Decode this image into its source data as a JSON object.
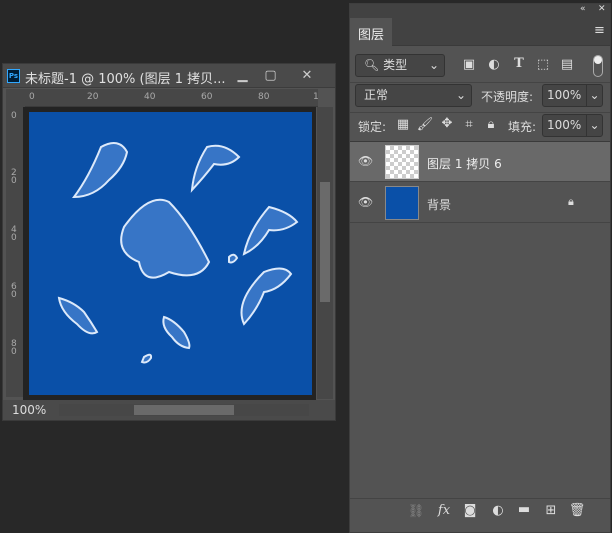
{
  "document": {
    "title": "未标题-1 @ 100% (图层 1 拷贝...",
    "app_icon": "Ps",
    "zoom": "100%",
    "ruler_top": [
      "0",
      "20",
      "40",
      "60",
      "80",
      "1"
    ],
    "ruler_left": [
      "0",
      "2\n0",
      "4\n0",
      "6\n0",
      "8\n0"
    ],
    "canvas_color": "#0a50a8"
  },
  "panel": {
    "tab": "图层",
    "filter": "类型",
    "blend_mode": "正常",
    "opacity_label": "不透明度:",
    "opacity": "100%",
    "lock_label": "锁定:",
    "fill_label": "填充:",
    "fill": "100%",
    "layers": [
      {
        "name": "图层 1 拷贝 6",
        "selected": true,
        "thumb": "transparent"
      },
      {
        "name": "背景",
        "selected": false,
        "thumb": "#0a50a8",
        "locked": true
      }
    ]
  }
}
